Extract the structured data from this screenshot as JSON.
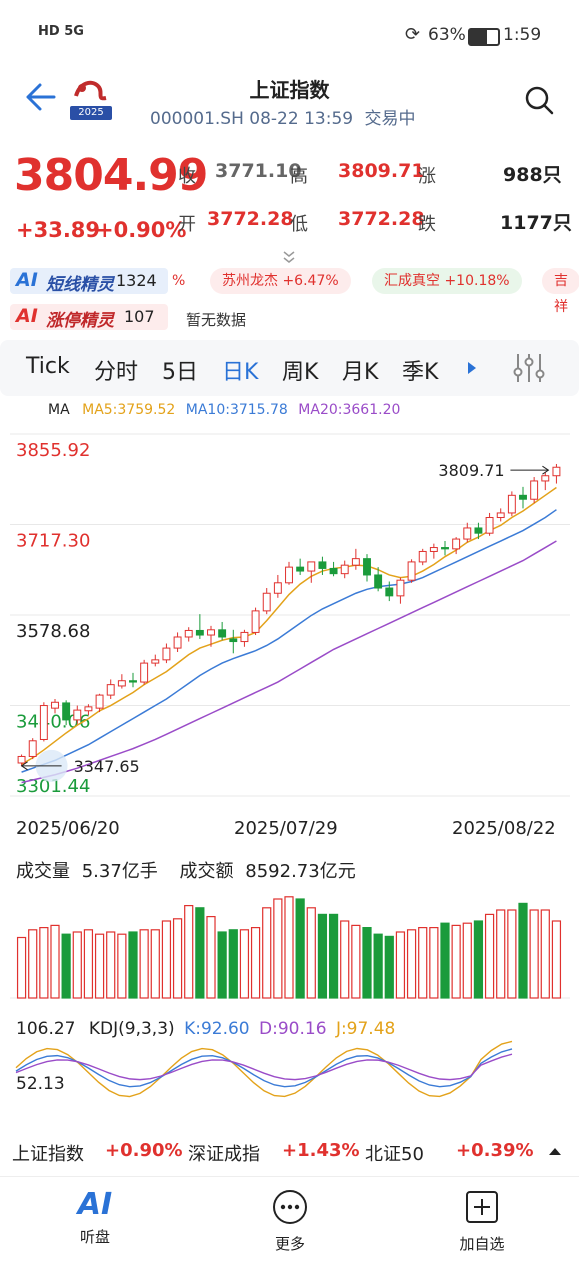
{
  "status_bar": {
    "left_icons": "HD 5G",
    "battery": "63%",
    "time": "1:59"
  },
  "header": {
    "title": "上证指数",
    "subtitle_code": "000001.SH",
    "subtitle_time": "08-22 13:59",
    "subtitle_status": "交易中",
    "logo_year": "2025"
  },
  "quote": {
    "price": "3804.99",
    "change": "+33.89",
    "change_pct": "+0.90%",
    "close_label": "收",
    "close_value": "3771.10",
    "high_label": "高",
    "high_value": "3809.71",
    "up_label": "涨",
    "up_count": "988只",
    "open_label": "开",
    "open_value": "3772.28",
    "low_label": "低",
    "low_value": "3772.28",
    "down_label": "跌",
    "down_count": "1177只"
  },
  "ai_rows": {
    "row1_label": "短线精灵",
    "row1_count": "1324",
    "row1_items": [
      "%",
      "苏州龙杰 +6.47%",
      "汇成真空 +10.18%",
      "吉祥"
    ],
    "row2_label": "涨停精灵",
    "row2_count": "107",
    "row2_text": "暂无数据",
    "ai_prefix": "AI"
  },
  "tabs": [
    "Tick",
    "分时",
    "5日",
    "日K",
    "周K",
    "月K",
    "季K"
  ],
  "active_tab": "日K",
  "ma_legend": {
    "ma": "MA",
    "ma5": "MA5:3759.52",
    "ma10": "MA10:3715.78",
    "ma20": "MA20:3661.20"
  },
  "colors": {
    "up": "#e0312e",
    "down": "#1a9b3b",
    "ma5": "#e3a21a",
    "ma10": "#3b7bd6",
    "ma20": "#9a4cc8",
    "accent": "#2a72d6"
  },
  "chart_data": {
    "type": "candlestick",
    "y_labels": [
      "3855.92",
      "3717.30",
      "3578.68",
      "3440.06",
      "3301.44"
    ],
    "x_labels": [
      "2025/06/20",
      "2025/07/29",
      "2025/08/22"
    ],
    "ylim": [
      3301.44,
      3855.92
    ],
    "high_marker": "3809.71",
    "low_marker": "3347.65",
    "ohlc": [
      [
        3352,
        3365,
        3347,
        3362
      ],
      [
        3362,
        3390,
        3358,
        3386
      ],
      [
        3388,
        3445,
        3385,
        3440
      ],
      [
        3436,
        3450,
        3428,
        3445
      ],
      [
        3444,
        3448,
        3410,
        3418
      ],
      [
        3418,
        3440,
        3412,
        3433
      ],
      [
        3432,
        3442,
        3425,
        3438
      ],
      [
        3436,
        3458,
        3430,
        3456
      ],
      [
        3456,
        3480,
        3450,
        3472
      ],
      [
        3470,
        3488,
        3466,
        3478
      ],
      [
        3478,
        3490,
        3468,
        3476
      ],
      [
        3476,
        3510,
        3472,
        3505
      ],
      [
        3505,
        3518,
        3500,
        3510
      ],
      [
        3510,
        3535,
        3505,
        3528
      ],
      [
        3528,
        3552,
        3522,
        3545
      ],
      [
        3545,
        3560,
        3538,
        3555
      ],
      [
        3555,
        3580,
        3542,
        3548
      ],
      [
        3548,
        3562,
        3530,
        3556
      ],
      [
        3556,
        3568,
        3540,
        3545
      ],
      [
        3542,
        3556,
        3520,
        3538
      ],
      [
        3538,
        3556,
        3530,
        3552
      ],
      [
        3552,
        3590,
        3548,
        3585
      ],
      [
        3585,
        3620,
        3580,
        3612
      ],
      [
        3612,
        3640,
        3605,
        3628
      ],
      [
        3628,
        3660,
        3625,
        3652
      ],
      [
        3652,
        3665,
        3640,
        3646
      ],
      [
        3646,
        3660,
        3628,
        3660
      ],
      [
        3660,
        3668,
        3640,
        3650
      ],
      [
        3650,
        3660,
        3638,
        3642
      ],
      [
        3642,
        3662,
        3635,
        3655
      ],
      [
        3655,
        3680,
        3648,
        3665
      ],
      [
        3665,
        3672,
        3630,
        3640
      ],
      [
        3640,
        3652,
        3615,
        3620
      ],
      [
        3620,
        3630,
        3600,
        3608
      ],
      [
        3608,
        3636,
        3596,
        3632
      ],
      [
        3632,
        3664,
        3628,
        3660
      ],
      [
        3660,
        3680,
        3655,
        3676
      ],
      [
        3676,
        3688,
        3665,
        3682
      ],
      [
        3682,
        3692,
        3670,
        3680
      ],
      [
        3680,
        3698,
        3672,
        3695
      ],
      [
        3695,
        3720,
        3690,
        3712
      ],
      [
        3712,
        3720,
        3695,
        3704
      ],
      [
        3704,
        3735,
        3700,
        3728
      ],
      [
        3728,
        3742,
        3722,
        3735
      ],
      [
        3735,
        3768,
        3730,
        3762
      ],
      [
        3762,
        3775,
        3742,
        3756
      ],
      [
        3756,
        3790,
        3750,
        3784
      ],
      [
        3784,
        3798,
        3770,
        3792
      ],
      [
        3792,
        3810,
        3780,
        3805
      ]
    ],
    "ma5": [
      3350,
      3360,
      3372,
      3385,
      3398,
      3410,
      3420,
      3432,
      3440,
      3450,
      3460,
      3472,
      3482,
      3492,
      3505,
      3518,
      3528,
      3534,
      3540,
      3544,
      3545,
      3552,
      3570,
      3590,
      3610,
      3626,
      3638,
      3646,
      3650,
      3652,
      3655,
      3654,
      3648,
      3640,
      3636,
      3638,
      3646,
      3656,
      3668,
      3678,
      3690,
      3698,
      3708,
      3716,
      3728,
      3738,
      3750,
      3762,
      3774
    ],
    "ma10": [
      3338,
      3344,
      3350,
      3356,
      3364,
      3372,
      3380,
      3390,
      3400,
      3410,
      3420,
      3430,
      3440,
      3450,
      3462,
      3474,
      3486,
      3496,
      3505,
      3512,
      3518,
      3524,
      3532,
      3542,
      3554,
      3566,
      3578,
      3588,
      3596,
      3604,
      3612,
      3618,
      3622,
      3624,
      3626,
      3630,
      3636,
      3644,
      3652,
      3660,
      3668,
      3676,
      3684,
      3692,
      3700,
      3708,
      3718,
      3728,
      3740
    ],
    "ma20": [
      3322,
      3326,
      3330,
      3334,
      3339,
      3344,
      3350,
      3356,
      3362,
      3368,
      3374,
      3381,
      3388,
      3396,
      3404,
      3412,
      3420,
      3428,
      3436,
      3444,
      3452,
      3460,
      3468,
      3476,
      3486,
      3496,
      3506,
      3516,
      3526,
      3534,
      3542,
      3550,
      3558,
      3566,
      3574,
      3582,
      3590,
      3598,
      3606,
      3614,
      3622,
      3630,
      3638,
      3646,
      3654,
      3662,
      3672,
      3682,
      3692
    ]
  },
  "volume": {
    "label1": "成交量",
    "value1": "5.37亿手",
    "label2": "成交额",
    "value2": "8592.73亿元",
    "bars": [
      0.55,
      0.62,
      0.64,
      0.66,
      0.58,
      0.6,
      0.62,
      0.58,
      0.6,
      0.58,
      0.6,
      0.62,
      0.62,
      0.7,
      0.72,
      0.84,
      0.82,
      0.74,
      0.6,
      0.62,
      0.62,
      0.64,
      0.82,
      0.9,
      0.92,
      0.9,
      0.82,
      0.76,
      0.76,
      0.7,
      0.66,
      0.64,
      0.58,
      0.56,
      0.6,
      0.62,
      0.64,
      0.64,
      0.68,
      0.66,
      0.68,
      0.7,
      0.76,
      0.8,
      0.8,
      0.86,
      0.8,
      0.8,
      0.7
    ]
  },
  "kdj": {
    "value": "106.27",
    "label": "KDJ(9,3,3)",
    "k": "K:92.60",
    "d": "D:90.16",
    "j": "J:97.48",
    "mid": "52.13"
  },
  "bottom_indices": [
    {
      "name": "上证指数",
      "change": "+0.90%"
    },
    {
      "name": "深证成指",
      "change": "+1.43%"
    },
    {
      "name": "北证50",
      "change": "+0.39%"
    }
  ],
  "nav": [
    {
      "label": "听盘",
      "icon": "ai-icon"
    },
    {
      "label": "更多",
      "icon": "more-icon"
    },
    {
      "label": "加自选",
      "icon": "add-watchlist-icon"
    }
  ]
}
